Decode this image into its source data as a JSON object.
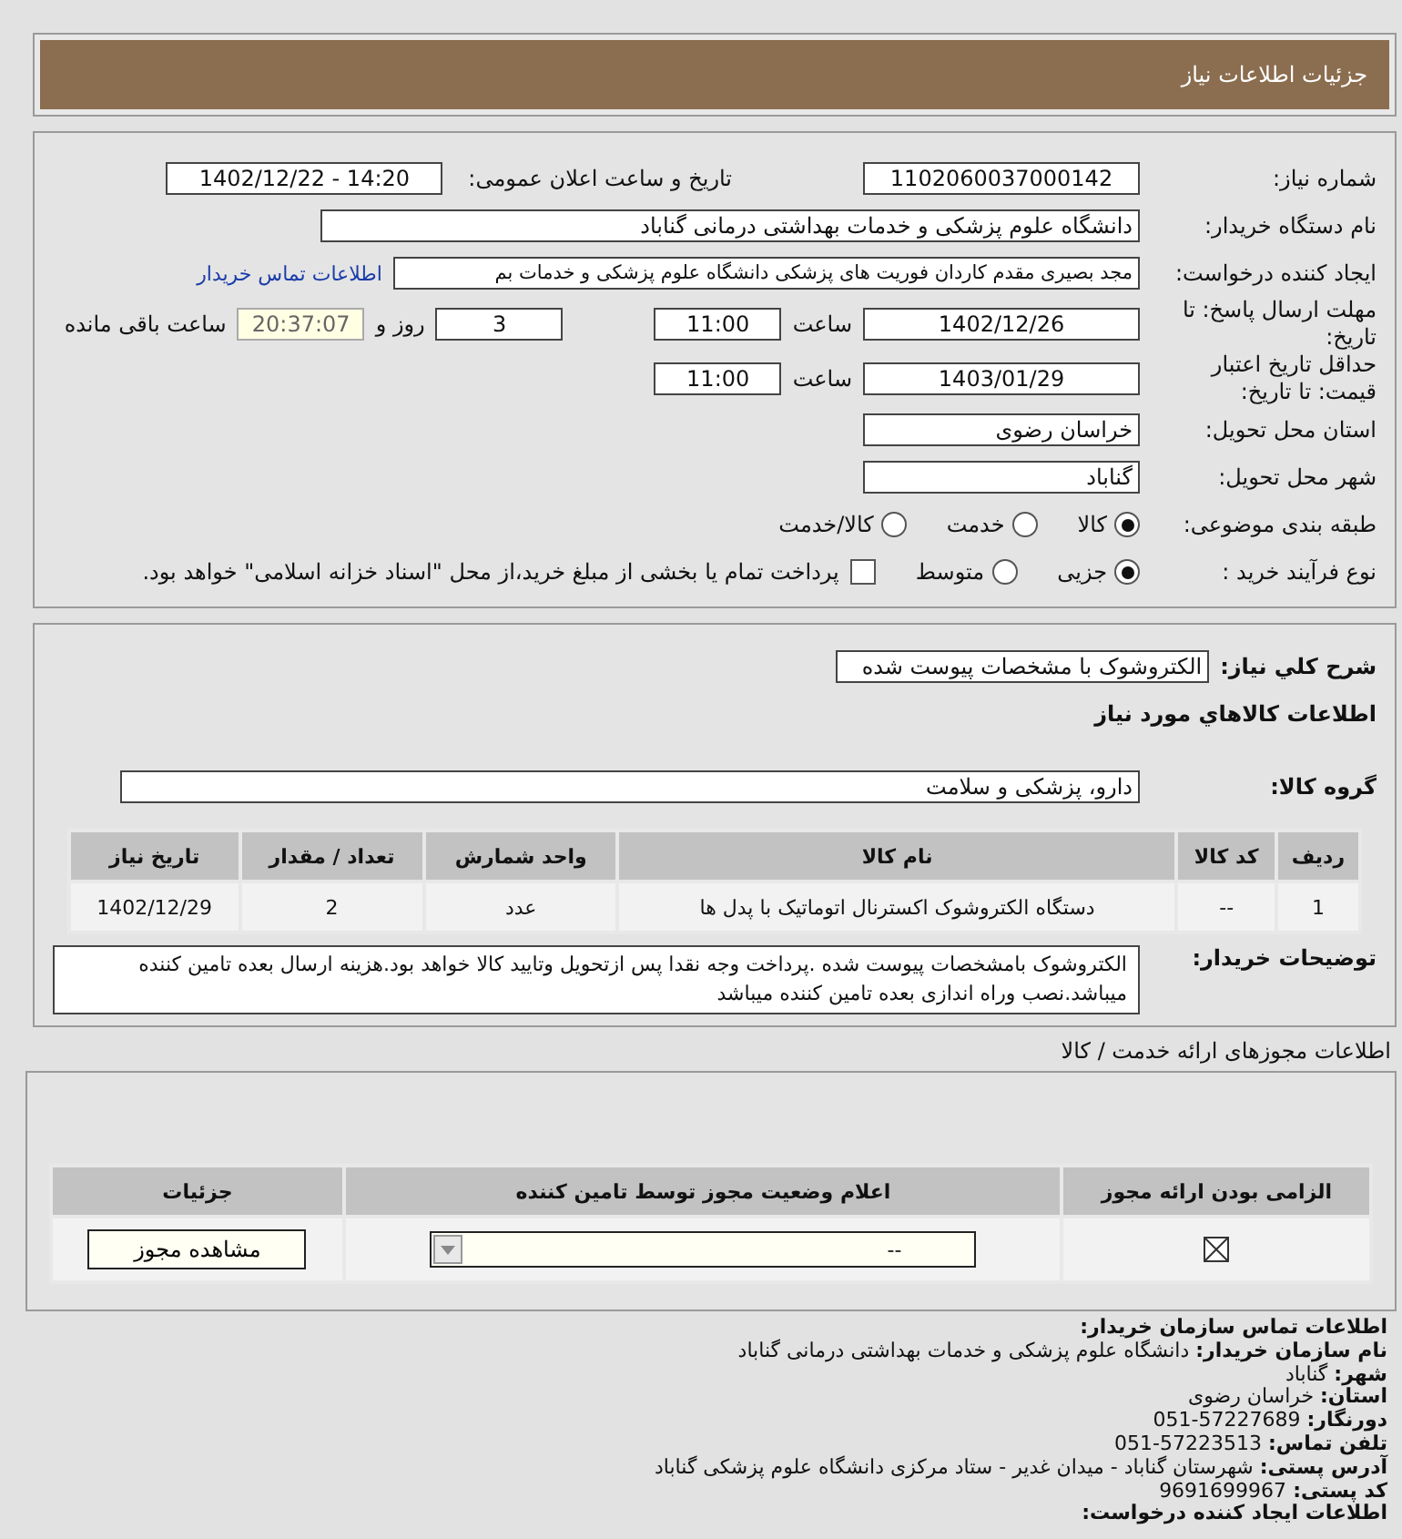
{
  "header": {
    "title": "جزئیات اطلاعات نیاز"
  },
  "need_info": {
    "need_number": {
      "label": "شماره نیاز:",
      "value": "1102060037000142"
    },
    "announce_datetime": {
      "label": "تاریخ و ساعت اعلان عمومی:",
      "value": "1402/12/22 - 14:20"
    },
    "buyer_org": {
      "label": "نام دستگاه خریدار:",
      "value": "دانشگاه علوم پزشکی و خدمات بهداشتی درمانی گناباد"
    },
    "requester": {
      "label": "ایجاد کننده درخواست:",
      "value": "مجد بصیری مقدم کاردان فوریت های پزشکی دانشگاه علوم پزشکی و خدمات بم",
      "link": "اطلاعات تماس خریدار"
    },
    "reply_deadline": {
      "label": "مهلت ارسال پاسخ: تا تاریخ:",
      "date": "1402/12/26",
      "time_label": "ساعت",
      "time": "11:00",
      "days": "3",
      "days_label": "روز و",
      "remaining": "20:37:07",
      "remaining_label": "ساعت باقی مانده"
    },
    "price_validity": {
      "label": "حداقل تاریخ اعتبار قیمت: تا تاریخ:",
      "date": "1403/01/29",
      "time_label": "ساعت",
      "time": "11:00"
    },
    "province": {
      "label": "استان محل تحویل:",
      "value": "خراسان رضوی"
    },
    "city": {
      "label": "شهر محل تحویل:",
      "value": "گناباد"
    },
    "category": {
      "label": "طبقه بندی موضوعی:",
      "options": [
        {
          "label": "کالا",
          "selected": true
        },
        {
          "label": "خدمت",
          "selected": false
        },
        {
          "label": "کالا/خدمت",
          "selected": false
        }
      ]
    },
    "purchase_type": {
      "label": "نوع فرآیند خرید :",
      "options": [
        {
          "label": "جزیی",
          "selected": true
        },
        {
          "label": "متوسط",
          "selected": false
        }
      ],
      "payment": {
        "label": "پرداخت تمام یا بخشی از مبلغ خرید،از محل \"اسناد خزانه اسلامی\" خواهد بود.",
        "checked": false
      }
    }
  },
  "goods": {
    "summary": {
      "label": "شرح کلي نياز:",
      "value": "الکتروشوک با مشخصات پیوست شده"
    },
    "heading": "اطلاعات کالاهاي مورد نياز",
    "group": {
      "label": "گروه کالا:",
      "value": "دارو، پزشکی و سلامت"
    },
    "table": {
      "columns": [
        "ردیف",
        "کد کالا",
        "نام کالا",
        "واحد شمارش",
        "تعداد / مقدار",
        "تاریخ نیاز"
      ],
      "rows": [
        [
          "1",
          "--",
          "دستگاه الکتروشوک اکسترنال اتوماتیک با پدل ها",
          "عدد",
          "2",
          "1402/12/29"
        ]
      ]
    },
    "notes": {
      "label": "توضیحات خریدار:",
      "value": "الکتروشوک بامشخصات پیوست شده .پرداخت وجه نقدا پس ازتحویل وتایید کالا خواهد بود.هزینه ارسال بعده تامین کننده میباشد.نصب وراه اندازی بعده تامین کننده میباشد"
    }
  },
  "licenses": {
    "heading": "اطلاعات مجوزهای ارائه خدمت / کالا",
    "columns": [
      "الزامی بودن ارائه مجوز",
      "اعلام وضعیت مجوز توسط تامین کننده",
      "جزئیات"
    ],
    "rows": [
      {
        "required": true,
        "status": "--",
        "button": "مشاهده مجوز"
      }
    ]
  },
  "contact": {
    "title": "اطلاعات تماس سازمان خریدار:",
    "lines": [
      {
        "label": "نام سازمان خریدار:",
        "value": "دانشگاه علوم پزشکی و خدمات بهداشتی درمانی گناباد"
      },
      {
        "label": "شهر:",
        "value": "گناباد"
      },
      {
        "label": "استان:",
        "value": "خراسان رضوی"
      },
      {
        "label": "دورنگار:",
        "value": "57227689-051"
      },
      {
        "label": "تلفن تماس:",
        "value": "57223513-051"
      },
      {
        "label": "آدرس پستی:",
        "value": "شهرستان گناباد - میدان غدیر - ستاد مرکزی دانشگاه علوم پزشکی گناباد"
      },
      {
        "label": "کد پستی:",
        "value": "9691699967"
      }
    ],
    "next_title": "اطلاعات ایجاد کننده درخواست:"
  }
}
